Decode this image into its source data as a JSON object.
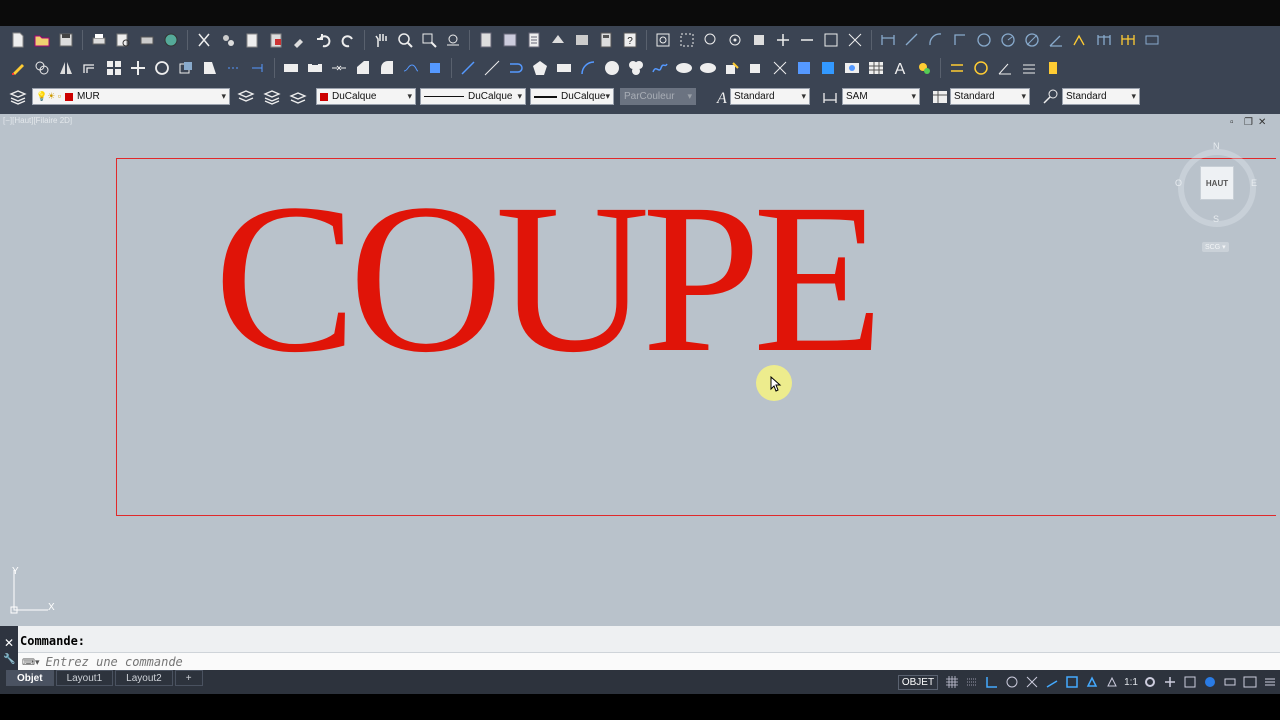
{
  "app": {
    "accent_color": "#e01408"
  },
  "toolbar": {
    "row1_icons": [
      "new-icon",
      "open-icon",
      "save-icon",
      "print-icon",
      "preview-icon",
      "plot-icon",
      "publish-icon",
      "cut-icon",
      "copy-icon",
      "paste-icon",
      "paste-special-icon",
      "matchprop-icon",
      "undo-icon",
      "redo-icon",
      "pan-icon",
      "zoom-realtime-icon",
      "zoom-window-icon",
      "zoom-previous-icon",
      "properties-icon",
      "designcenter-icon",
      "toolpalettes-icon",
      "sheetset-icon",
      "markup-icon",
      "calculator-icon",
      "help-icon"
    ],
    "row2_icons": [
      "erase-icon",
      "copy-object-icon",
      "mirror-icon",
      "offset-icon",
      "array-icon",
      "move-icon",
      "rotate-icon",
      "scale-icon",
      "stretch-icon",
      "trim-icon",
      "extend-icon",
      "break-icon",
      "join-icon",
      "chamfer-icon",
      "fillet-icon",
      "blend-icon",
      "explode-icon"
    ],
    "layer": {
      "current": "MUR"
    },
    "color": {
      "current": "DuCalque"
    },
    "linetype": {
      "current": "DuCalque"
    },
    "lineweight": {
      "current": "DuCalque"
    },
    "plotstyle": {
      "current": "ParCouleur"
    },
    "text_style": {
      "current": "Standard"
    },
    "dim_style": {
      "current": "SAM"
    },
    "table_style": {
      "current": "Standard"
    },
    "mleader_style": {
      "current": "Standard"
    }
  },
  "viewport": {
    "label": "[−][Haut][Filaire 2D]",
    "drawing_text": "COUPE",
    "drawing_text_color": "#e01408",
    "border_color": "#e0282a"
  },
  "viewcube": {
    "face": "HAUT",
    "north": "N",
    "south": "S",
    "east": "E",
    "west": "O",
    "wcs": "SCG"
  },
  "ucs": {
    "x": "X",
    "y": "Y"
  },
  "command": {
    "label": "Commande:",
    "placeholder": "Entrez une commande"
  },
  "status": {
    "tabs": [
      {
        "label": "Objet",
        "active": true
      },
      {
        "label": "Layout1",
        "active": false
      },
      {
        "label": "Layout2",
        "active": false
      }
    ],
    "add_tab": "+",
    "space": "OBJET",
    "annotation_scale": "1:1"
  }
}
